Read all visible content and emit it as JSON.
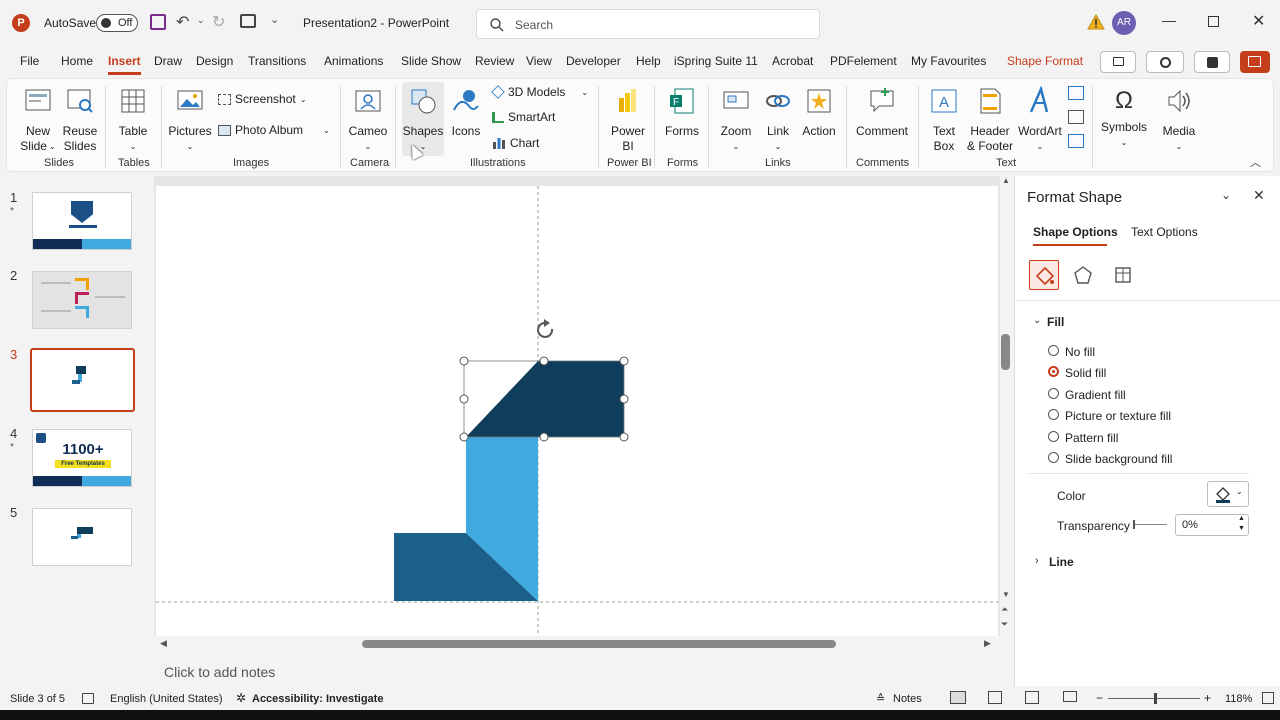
{
  "titlebar": {
    "autosave_label": "AutoSave",
    "autosave_state": "Off",
    "doc_title": "Presentation2  -  PowerPoint",
    "search_placeholder": "Search",
    "user_initials": "AR"
  },
  "menu": {
    "tabs": [
      "File",
      "Home",
      "Insert",
      "Draw",
      "Design",
      "Transitions",
      "Animations",
      "Slide Show",
      "Review",
      "View",
      "Developer",
      "Help",
      "iSpring Suite 11",
      "Acrobat",
      "PDFelement",
      "My Favourites",
      "Shape Format"
    ],
    "active": "Insert"
  },
  "ribbon": {
    "new_slide": "New\nSlide",
    "new_slide_l1": "New",
    "new_slide_l2": "Slide",
    "reuse_l1": "Reuse",
    "reuse_l2": "Slides",
    "table": "Table",
    "pictures": "Pictures",
    "screenshot": "Screenshot",
    "photo_album": "Photo Album",
    "cameo": "Cameo",
    "shapes": "Shapes",
    "icons": "Icons",
    "models3d": "3D Models",
    "smartart": "SmartArt",
    "chart": "Chart",
    "powerbi_l1": "Power",
    "powerbi_l2": "BI",
    "forms": "Forms",
    "zoom": "Zoom",
    "link": "Link",
    "action": "Action",
    "comment": "Comment",
    "textbox_l1": "Text",
    "textbox_l2": "Box",
    "header_l1": "Header",
    "header_l2": "& Footer",
    "wordart": "WordArt",
    "symbols": "Symbols",
    "media": "Media",
    "groups": {
      "slides": "Slides",
      "tables": "Tables",
      "images": "Images",
      "camera": "Camera",
      "illustrations": "Illustrations",
      "powerbi": "Power BI",
      "forms": "Forms",
      "links": "Links",
      "comments": "Comments",
      "text": "Text"
    }
  },
  "slides_panel": {
    "numbers": [
      "1",
      "2",
      "3",
      "4",
      "5"
    ],
    "selected": 3,
    "thumb4_text": "1100+",
    "thumb4_sub": "Free Templates"
  },
  "format_pane": {
    "title": "Format Shape",
    "tab_shape": "Shape Options",
    "tab_text": "Text Options",
    "fill_header": "Fill",
    "fill_options": [
      "No fill",
      "Solid fill",
      "Gradient fill",
      "Picture or texture fill",
      "Pattern fill",
      "Slide background fill"
    ],
    "fill_selected": "Solid fill",
    "color_label": "Color",
    "transparency_label": "Transparency",
    "transparency_value": "0%",
    "line_header": "Line"
  },
  "notes": {
    "placeholder": "Click to add notes"
  },
  "status": {
    "slide_info": "Slide 3 of 5",
    "language": "English (United States)",
    "accessibility": "Accessibility: Investigate",
    "notes_btn": "Notes",
    "zoom": "118%"
  },
  "colors": {
    "accent": "#c43e1c",
    "shape_dark": "#0f3d5c",
    "shape_mid": "#1a6088",
    "shape_light": "#3fa9e0"
  }
}
